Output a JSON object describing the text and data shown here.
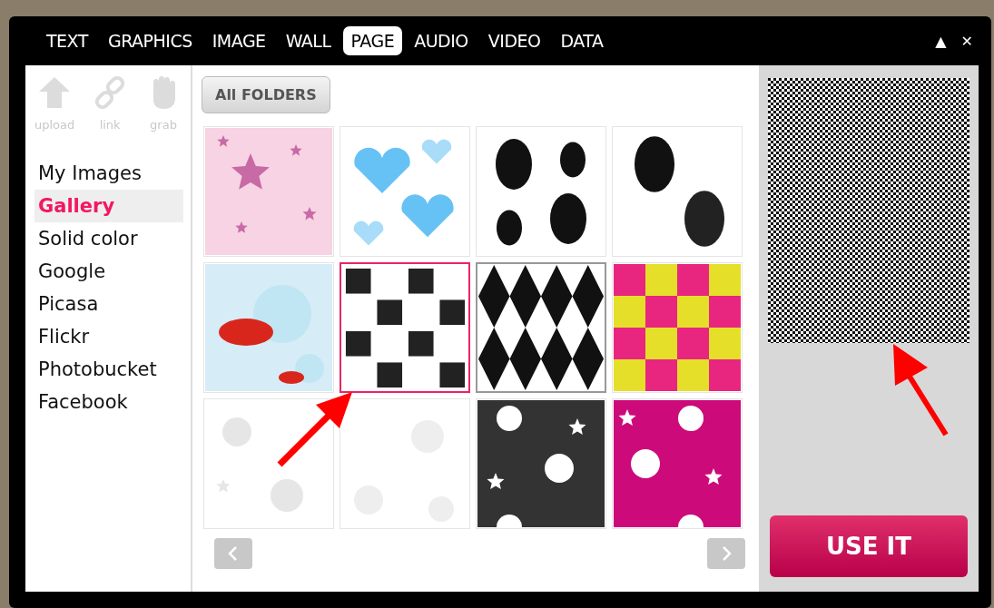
{
  "tabs": [
    {
      "label": "TEXT",
      "selected": false
    },
    {
      "label": "GRAPHICS",
      "selected": false
    },
    {
      "label": "IMAGE",
      "selected": false
    },
    {
      "label": "WALL",
      "selected": false
    },
    {
      "label": "PAGE",
      "selected": true
    },
    {
      "label": "AUDIO",
      "selected": false
    },
    {
      "label": "VIDEO",
      "selected": false
    },
    {
      "label": "DATA",
      "selected": false
    }
  ],
  "window_controls": [
    "▲",
    "✕"
  ],
  "sources": [
    {
      "label": "upload",
      "kind": "upload"
    },
    {
      "label": "link",
      "kind": "link"
    },
    {
      "label": "grab",
      "kind": "grab"
    }
  ],
  "sidebar": {
    "items": [
      {
        "label": "My Images",
        "selected": false
      },
      {
        "label": "Gallery",
        "selected": true
      },
      {
        "label": "Solid color",
        "selected": false
      },
      {
        "label": "Google",
        "selected": false
      },
      {
        "label": "Picasa",
        "selected": false
      },
      {
        "label": "Flickr",
        "selected": false
      },
      {
        "label": "Photobucket",
        "selected": false
      },
      {
        "label": "Facebook",
        "selected": false
      }
    ]
  },
  "folder_button": "All FOLDERS",
  "tiles": [
    {
      "kind": "picture",
      "selected": false,
      "hovered": false
    },
    {
      "kind": "picture",
      "selected": false,
      "hovered": false
    },
    {
      "kind": "picture",
      "selected": false,
      "hovered": false
    },
    {
      "kind": "picture",
      "selected": false,
      "hovered": false
    },
    {
      "kind": "picture",
      "selected": false,
      "hovered": false
    },
    {
      "kind": "picture",
      "selected": true,
      "hovered": false
    },
    {
      "kind": "picture",
      "selected": false,
      "hovered": true
    },
    {
      "kind": "picture",
      "selected": false,
      "hovered": false
    },
    {
      "kind": "picture",
      "selected": false,
      "hovered": false
    },
    {
      "kind": "picture",
      "selected": false,
      "hovered": false
    },
    {
      "kind": "picture",
      "selected": false,
      "hovered": false
    },
    {
      "kind": "picture",
      "selected": false,
      "hovered": false
    }
  ],
  "use_button": "USE IT"
}
